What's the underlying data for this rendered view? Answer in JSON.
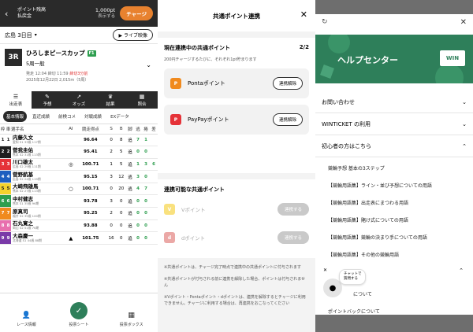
{
  "panel1": {
    "topbar": {
      "back_glyph": "‹",
      "points_label": "ポイント残高",
      "payment_label": "払戻金",
      "balance": "1,000pt",
      "balance_sub": "表示する",
      "charge": "チャージ"
    },
    "race_select": {
      "label": "広島 3日目",
      "chev": "▾",
      "live": "▶ ライブ映像"
    },
    "race": {
      "no": "3R",
      "name": "ひろしまピースカップ",
      "grade": "F1",
      "sub": "5周一般",
      "time_prefix": "発走 12:04 締切 11:59",
      "time_alert": "締切3分前",
      "date": "2025年12月22日 2,015m（5周）",
      "chev": "⌄"
    },
    "tabs": [
      {
        "icon": "☰",
        "label": "出走表"
      },
      {
        "icon": "✎",
        "label": "予想"
      },
      {
        "icon": "↗",
        "label": "オッズ"
      },
      {
        "icon": "♛",
        "label": "結果"
      },
      {
        "icon": "▦",
        "label": "照合"
      }
    ],
    "subtabs": [
      "基本情報",
      "直近成績",
      "前検コメ",
      "対戦成績",
      "EXデータ"
    ],
    "table": {
      "headers": [
        "枠",
        "車",
        "選手名",
        "AI",
        "競走得点",
        "S",
        "B",
        "脚",
        "逃",
        "捲",
        "差"
      ],
      "rows": [
        {
          "frame": "1",
          "car": "1",
          "name": "内藤久文",
          "sub": "愛知 S1 33歳 117期",
          "ai": "",
          "score": "96.64",
          "s": "0",
          "b": "8",
          "leg": "追",
          "nige": "7",
          "makuri": "1",
          "sashi": ""
        },
        {
          "frame": "2",
          "car": "2",
          "name": "菅我圭佑",
          "sub": "熊本 S2 31歳 113期",
          "ai": "",
          "score": "95.41",
          "s": "2",
          "b": "5",
          "leg": "追",
          "nige": "0",
          "makuri": "0",
          "sashi": ""
        },
        {
          "frame": "3",
          "car": "3",
          "name": "川口雄太",
          "sub": "広島 S2 29歳 111期",
          "ai": "◎",
          "score": "100.71",
          "s": "1",
          "b": "5",
          "leg": "追",
          "nige": "1",
          "makuri": "3",
          "sashi": "6"
        },
        {
          "frame": "4",
          "car": "4",
          "name": "菅野航基",
          "sub": "広島 S2 24歳 119期",
          "ai": "",
          "score": "95.15",
          "s": "3",
          "b": "12",
          "leg": "逃",
          "nige": "3",
          "makuri": "0",
          "sashi": ""
        },
        {
          "frame": "5",
          "car": "5",
          "name": "大崎飛雄馬",
          "sub": "熊本 S2 27歳 113期",
          "ai": "○",
          "score": "100.71",
          "s": "0",
          "b": "20",
          "leg": "逃",
          "nige": "4",
          "makuri": "7",
          "sashi": ""
        },
        {
          "frame": "6",
          "car": "6",
          "name": "中村健志",
          "sub": "熊本 S1 35歳 96期",
          "ai": "",
          "score": "93.78",
          "s": "3",
          "b": "0",
          "leg": "追",
          "nige": "0",
          "makuri": "0",
          "sashi": ""
        },
        {
          "frame": "7",
          "car": "7",
          "name": "原真司",
          "sub": "福井 S2 35歳 100期",
          "ai": "",
          "score": "95.25",
          "s": "2",
          "b": "0",
          "leg": "追",
          "nige": "0",
          "makuri": "0",
          "sashi": ""
        },
        {
          "frame": "8",
          "car": "8",
          "name": "石丸寛之",
          "sub": "岡山 S2 51歳 76期",
          "ai": "",
          "score": "93.88",
          "s": "0",
          "b": "0",
          "leg": "追",
          "nige": "0",
          "makuri": "0",
          "sashi": ""
        },
        {
          "frame": "9",
          "car": "9",
          "name": "大森慶一",
          "sub": "北海道 S1 44歳 88期",
          "ai": "▲",
          "score": "101.75",
          "s": "16",
          "b": "0",
          "leg": "追",
          "nige": "0",
          "makuri": "0",
          "sashi": ""
        }
      ]
    },
    "bottom_nav": [
      {
        "icon": "👤",
        "label": "レース情報"
      },
      {
        "icon": "✓",
        "label": "投票シート"
      },
      {
        "icon": "▦",
        "label": "投票ボックス"
      }
    ]
  },
  "panel2": {
    "title": "共通ポイント連携",
    "close": "✕",
    "current": {
      "heading": "現在連携中の共通ポイント",
      "count": "2/2",
      "desc": "200円チャージするたびに、それぞれ1pt貯まります",
      "items": [
        {
          "logo": "P",
          "name": "Pontaポイント",
          "button": "連携解除",
          "color": "#f08a1e"
        },
        {
          "logo": "P",
          "name": "PayPayポイント",
          "button": "連携解除",
          "color": "#e53238"
        }
      ]
    },
    "available": {
      "heading": "連携可能な共通ポイント",
      "items": [
        {
          "logo": "V",
          "name": "Vポイント",
          "button": "連携する",
          "color": "#f5c400"
        },
        {
          "logo": "d",
          "name": "dポイント",
          "button": "連携する",
          "color": "#d9534f"
        }
      ]
    },
    "notes": [
      "※共通ポイントは、チャージ完了時点で連携中の共通ポイントに付与されます",
      "※共通ポイントが付与される前に連携を解除した場合、ポイントは付与されません",
      "※Vポイント・Pontaポイント・dポイントは、連携を解除するとチャージに利用できません。チャージに利用する場合は、再連携をおこなってください"
    ]
  },
  "panel3": {
    "refresh": "↻",
    "close": "✕",
    "banner_title": "ヘルプセンター",
    "banner_logo": "WIN",
    "categories": [
      {
        "label": "お問い合わせ",
        "chev": "⌄"
      },
      {
        "label": "WINTICKET の利用",
        "chev": "⌄"
      },
      {
        "label": "初心者の方はこちら",
        "chev": "⌃"
      }
    ],
    "subitems": [
      "競輪予想 基本の3ステップ",
      "【競輪用語集】ライン・並び予想についての用語",
      "【競輪用語集】出走表にまつわる用語",
      "【競輪用語集】賭け式についての用語",
      "【競輪用語集】競輪の決まり手についての用語",
      "【競輪用語集】その他の競輪用語"
    ],
    "lower_chev": "⌃",
    "chat_bubble_1": "チャットで",
    "chat_bubble_2": "質問する",
    "chat_close": "✕",
    "bottom_items": [
      "について",
      "ポイントバックについて"
    ]
  }
}
